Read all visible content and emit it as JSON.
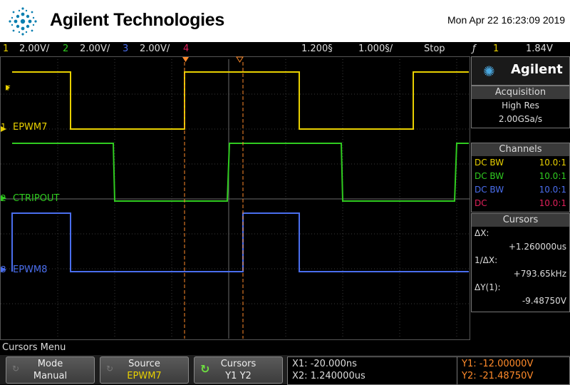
{
  "header": {
    "brand": "Agilent Technologies",
    "datetime": "Mon Apr 22 16:23:09 2019"
  },
  "status": {
    "ch1_num": "1",
    "ch1_scale": "2.00V/",
    "ch2_num": "2",
    "ch2_scale": "2.00V/",
    "ch3_num": "3",
    "ch3_scale": "2.00V/",
    "ch4_num": "4",
    "delay": "1.200§",
    "timebase": "1.000§/",
    "run_state": "Stop",
    "trig_icon": "ƒ",
    "trig_ch": "1",
    "trig_level": "1.84V"
  },
  "channels_labels": {
    "ch1": "EPWM7",
    "ch1_marker": "1",
    "ch2": "CTRIPOUT",
    "ch2_marker": "2",
    "ch3": "EPWM8",
    "ch3_marker": "3",
    "trig_marker": "T"
  },
  "sidebar": {
    "logo_text": "Agilent",
    "acquisition": {
      "title": "Acquisition",
      "mode": "High Res",
      "rate": "2.00GSa/s"
    },
    "channels": {
      "title": "Channels",
      "rows": [
        {
          "coupling": "DC BW",
          "probe": "10.0:1"
        },
        {
          "coupling": "DC BW",
          "probe": "10.0:1"
        },
        {
          "coupling": "DC BW",
          "probe": "10.0:1"
        },
        {
          "coupling": "DC",
          "probe": "10.0:1"
        }
      ]
    },
    "cursors": {
      "title": "Cursors",
      "dx_label": "ΔX:",
      "dx_value": "+1.260000us",
      "inv_label": "1/ΔX:",
      "inv_value": "+793.65kHz",
      "dy_label": "ΔY(1):",
      "dy_value": "-9.48750V"
    }
  },
  "menu": {
    "title": "Cursors Menu",
    "keys": [
      {
        "top": "Mode",
        "bottom": "Manual"
      },
      {
        "top": "Source",
        "bottom": "EPWM7"
      },
      {
        "top": "Cursors",
        "bottom": "Y1 Y2"
      }
    ],
    "x1": "X1: -20.000ns",
    "x2": "X2: 1.240000us",
    "y1": "Y1: -12.00000V",
    "y2": "Y2: -21.48750V"
  },
  "colors": {
    "ch1": "#e8d000",
    "ch2": "#30cc20",
    "ch3": "#4a6eee",
    "ch4": "#e0205a",
    "cursor": "#ff8a2a"
  }
}
